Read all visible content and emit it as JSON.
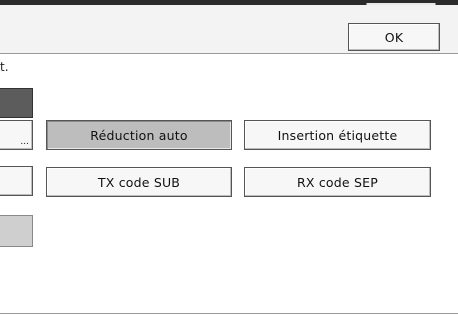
{
  "header": {
    "ok_label": "OK"
  },
  "status_text": "t.",
  "left_partial": {
    "ellipsis": "..."
  },
  "options": {
    "reduction_auto": "Réduction auto",
    "insertion_etiquette": "Insertion étiquette",
    "tx_code_sub": "TX code SUB",
    "rx_code_sep": "RX code SEP"
  }
}
